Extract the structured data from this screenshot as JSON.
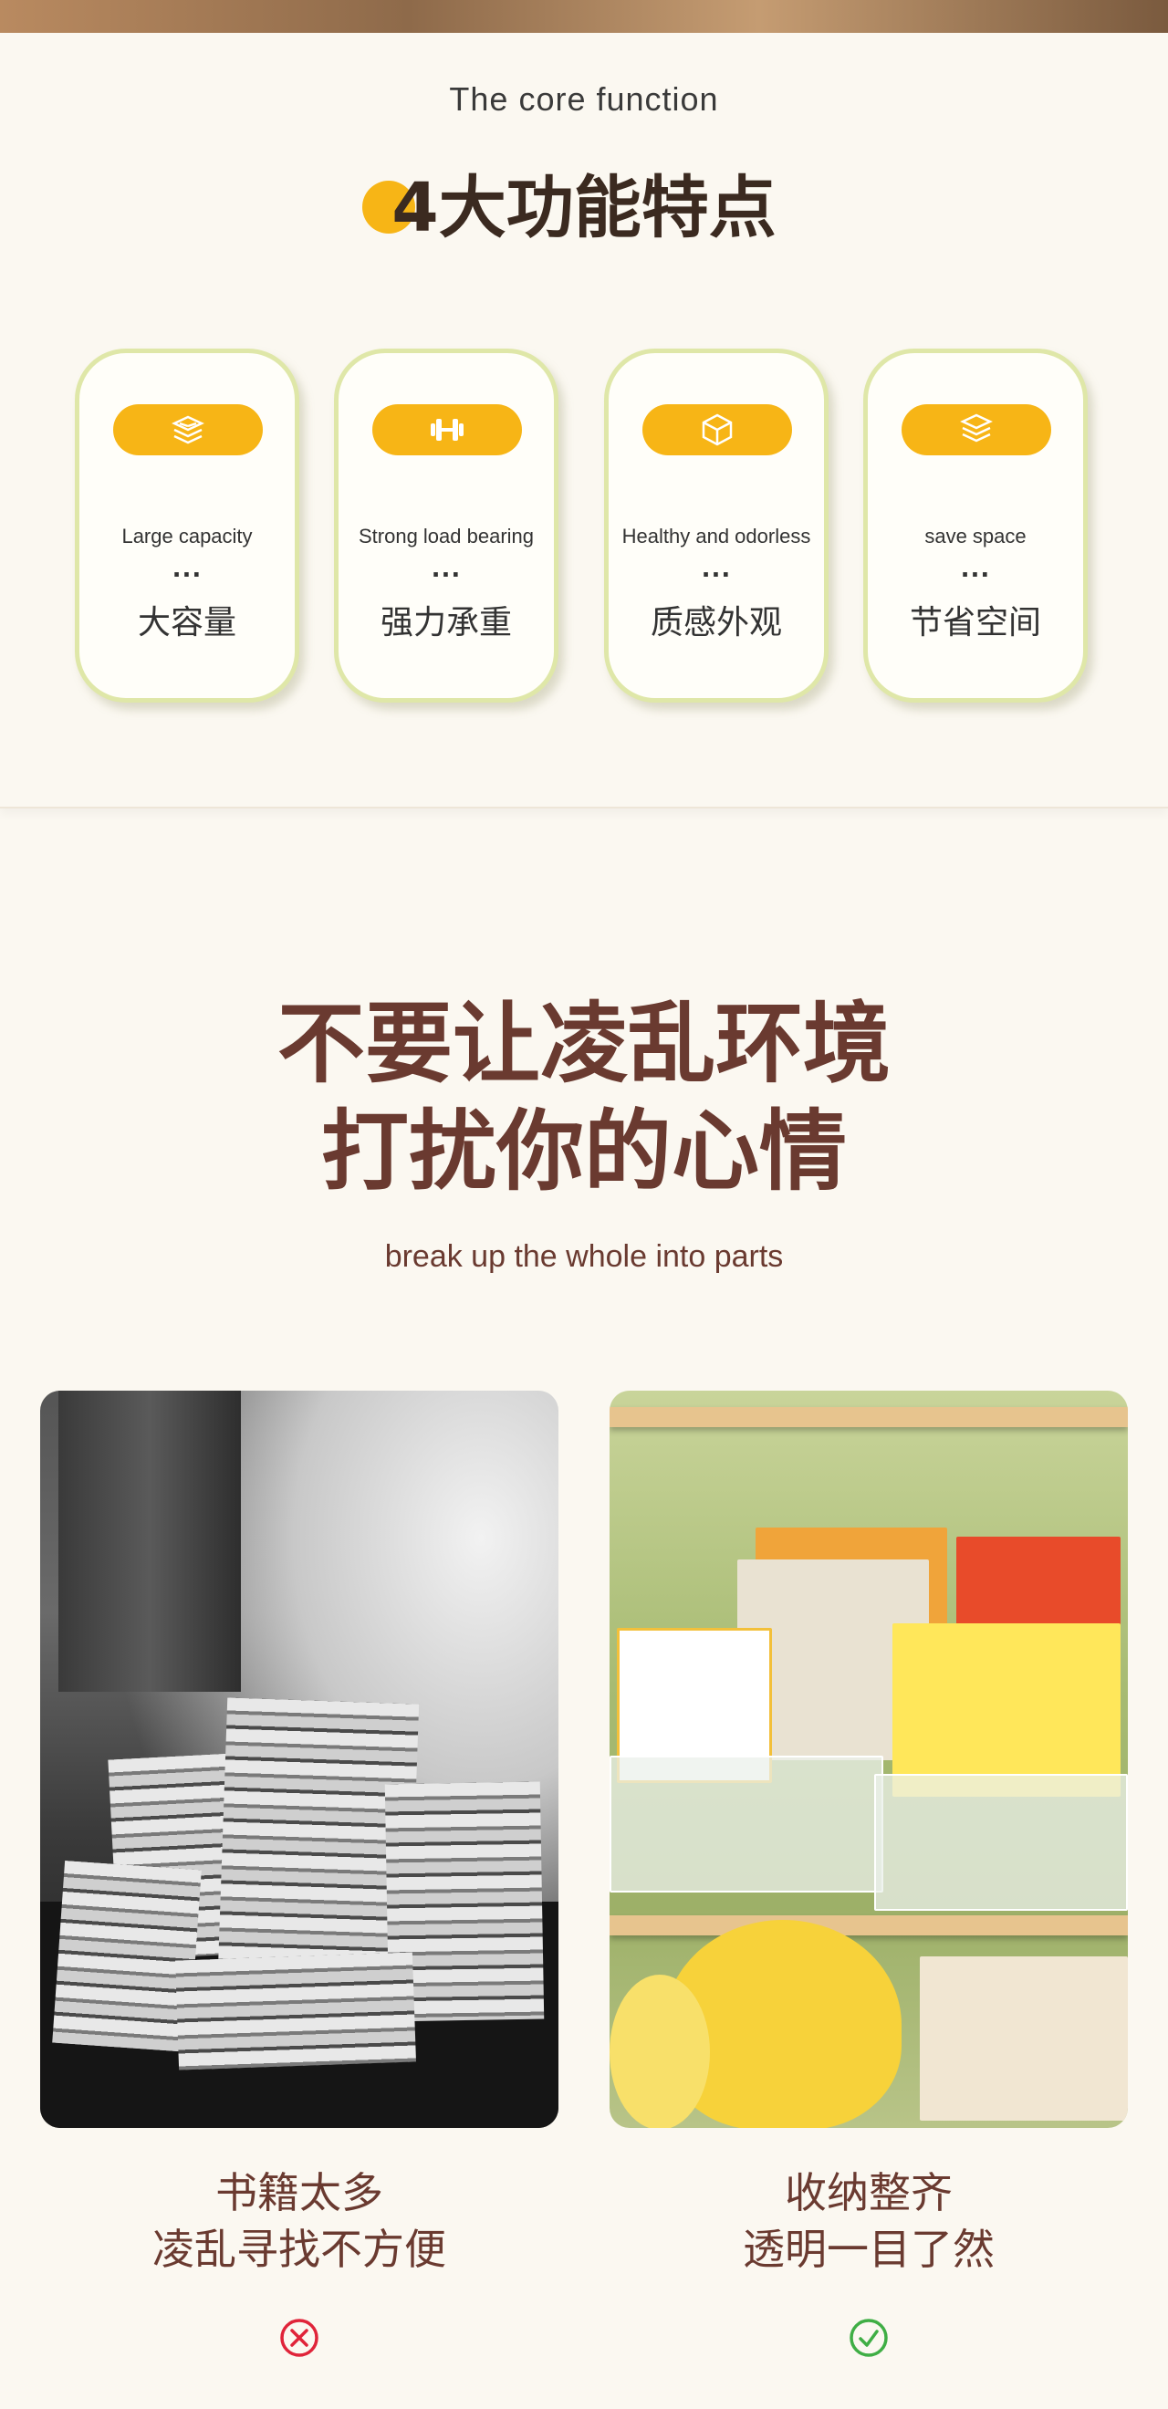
{
  "core": {
    "subtitle": "The core function",
    "title_number": "4",
    "title_text": "大功能特点"
  },
  "features": [
    {
      "icon": "stack-layers-icon",
      "en": "Large capacity",
      "dots": "...",
      "cn": "大容量"
    },
    {
      "icon": "dumbbell-icon",
      "en": "Strong load bearing",
      "dots": "...",
      "cn": "强力承重"
    },
    {
      "icon": "cube-icon",
      "en": "Healthy and odorless",
      "dots": "...",
      "cn": "质感外观"
    },
    {
      "icon": "layers-icon",
      "en": "save space",
      "dots": "...",
      "cn": "节省空间"
    }
  ],
  "headline": {
    "line1": "不要让凌乱环境",
    "line2": "打扰你的心情",
    "subtitle": "break up the whole into parts"
  },
  "comparison": [
    {
      "line1": "书籍太多",
      "line2": "凌乱寻找不方便",
      "status_icon": "cross-circle-icon",
      "color": "#e0243a"
    },
    {
      "line1": "收纳整齐",
      "line2": "透明一目了然",
      "status_icon": "check-circle-icon",
      "color": "#3fae45"
    }
  ],
  "colors": {
    "accent": "#f7b516",
    "card_border": "#dfe7a8",
    "headline": "#6a3a30",
    "background": "#fbf8f1"
  }
}
